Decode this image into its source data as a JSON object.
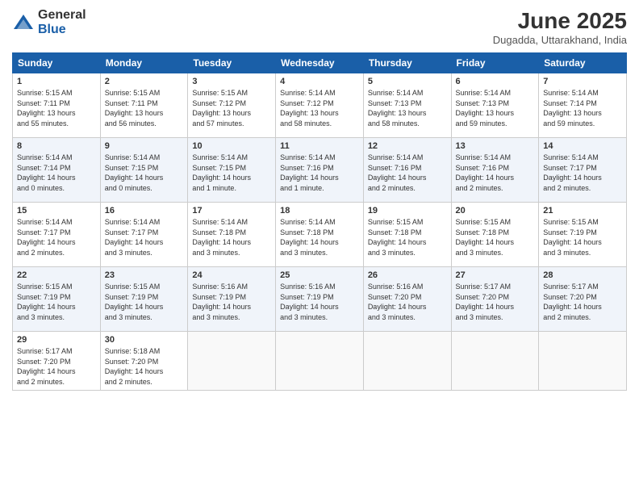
{
  "header": {
    "logo_general": "General",
    "logo_blue": "Blue",
    "month_title": "June 2025",
    "location": "Dugadda, Uttarakhand, India"
  },
  "days_of_week": [
    "Sunday",
    "Monday",
    "Tuesday",
    "Wednesday",
    "Thursday",
    "Friday",
    "Saturday"
  ],
  "weeks": [
    [
      {
        "day": "1",
        "info": "Sunrise: 5:15 AM\nSunset: 7:11 PM\nDaylight: 13 hours\nand 55 minutes."
      },
      {
        "day": "2",
        "info": "Sunrise: 5:15 AM\nSunset: 7:11 PM\nDaylight: 13 hours\nand 56 minutes."
      },
      {
        "day": "3",
        "info": "Sunrise: 5:15 AM\nSunset: 7:12 PM\nDaylight: 13 hours\nand 57 minutes."
      },
      {
        "day": "4",
        "info": "Sunrise: 5:14 AM\nSunset: 7:12 PM\nDaylight: 13 hours\nand 58 minutes."
      },
      {
        "day": "5",
        "info": "Sunrise: 5:14 AM\nSunset: 7:13 PM\nDaylight: 13 hours\nand 58 minutes."
      },
      {
        "day": "6",
        "info": "Sunrise: 5:14 AM\nSunset: 7:13 PM\nDaylight: 13 hours\nand 59 minutes."
      },
      {
        "day": "7",
        "info": "Sunrise: 5:14 AM\nSunset: 7:14 PM\nDaylight: 13 hours\nand 59 minutes."
      }
    ],
    [
      {
        "day": "8",
        "info": "Sunrise: 5:14 AM\nSunset: 7:14 PM\nDaylight: 14 hours\nand 0 minutes."
      },
      {
        "day": "9",
        "info": "Sunrise: 5:14 AM\nSunset: 7:15 PM\nDaylight: 14 hours\nand 0 minutes."
      },
      {
        "day": "10",
        "info": "Sunrise: 5:14 AM\nSunset: 7:15 PM\nDaylight: 14 hours\nand 1 minute."
      },
      {
        "day": "11",
        "info": "Sunrise: 5:14 AM\nSunset: 7:16 PM\nDaylight: 14 hours\nand 1 minute."
      },
      {
        "day": "12",
        "info": "Sunrise: 5:14 AM\nSunset: 7:16 PM\nDaylight: 14 hours\nand 2 minutes."
      },
      {
        "day": "13",
        "info": "Sunrise: 5:14 AM\nSunset: 7:16 PM\nDaylight: 14 hours\nand 2 minutes."
      },
      {
        "day": "14",
        "info": "Sunrise: 5:14 AM\nSunset: 7:17 PM\nDaylight: 14 hours\nand 2 minutes."
      }
    ],
    [
      {
        "day": "15",
        "info": "Sunrise: 5:14 AM\nSunset: 7:17 PM\nDaylight: 14 hours\nand 2 minutes."
      },
      {
        "day": "16",
        "info": "Sunrise: 5:14 AM\nSunset: 7:17 PM\nDaylight: 14 hours\nand 3 minutes."
      },
      {
        "day": "17",
        "info": "Sunrise: 5:14 AM\nSunset: 7:18 PM\nDaylight: 14 hours\nand 3 minutes."
      },
      {
        "day": "18",
        "info": "Sunrise: 5:14 AM\nSunset: 7:18 PM\nDaylight: 14 hours\nand 3 minutes."
      },
      {
        "day": "19",
        "info": "Sunrise: 5:15 AM\nSunset: 7:18 PM\nDaylight: 14 hours\nand 3 minutes."
      },
      {
        "day": "20",
        "info": "Sunrise: 5:15 AM\nSunset: 7:18 PM\nDaylight: 14 hours\nand 3 minutes."
      },
      {
        "day": "21",
        "info": "Sunrise: 5:15 AM\nSunset: 7:19 PM\nDaylight: 14 hours\nand 3 minutes."
      }
    ],
    [
      {
        "day": "22",
        "info": "Sunrise: 5:15 AM\nSunset: 7:19 PM\nDaylight: 14 hours\nand 3 minutes."
      },
      {
        "day": "23",
        "info": "Sunrise: 5:15 AM\nSunset: 7:19 PM\nDaylight: 14 hours\nand 3 minutes."
      },
      {
        "day": "24",
        "info": "Sunrise: 5:16 AM\nSunset: 7:19 PM\nDaylight: 14 hours\nand 3 minutes."
      },
      {
        "day": "25",
        "info": "Sunrise: 5:16 AM\nSunset: 7:19 PM\nDaylight: 14 hours\nand 3 minutes."
      },
      {
        "day": "26",
        "info": "Sunrise: 5:16 AM\nSunset: 7:20 PM\nDaylight: 14 hours\nand 3 minutes."
      },
      {
        "day": "27",
        "info": "Sunrise: 5:17 AM\nSunset: 7:20 PM\nDaylight: 14 hours\nand 3 minutes."
      },
      {
        "day": "28",
        "info": "Sunrise: 5:17 AM\nSunset: 7:20 PM\nDaylight: 14 hours\nand 2 minutes."
      }
    ],
    [
      {
        "day": "29",
        "info": "Sunrise: 5:17 AM\nSunset: 7:20 PM\nDaylight: 14 hours\nand 2 minutes."
      },
      {
        "day": "30",
        "info": "Sunrise: 5:18 AM\nSunset: 7:20 PM\nDaylight: 14 hours\nand 2 minutes."
      },
      {
        "day": "",
        "info": ""
      },
      {
        "day": "",
        "info": ""
      },
      {
        "day": "",
        "info": ""
      },
      {
        "day": "",
        "info": ""
      },
      {
        "day": "",
        "info": ""
      }
    ]
  ]
}
